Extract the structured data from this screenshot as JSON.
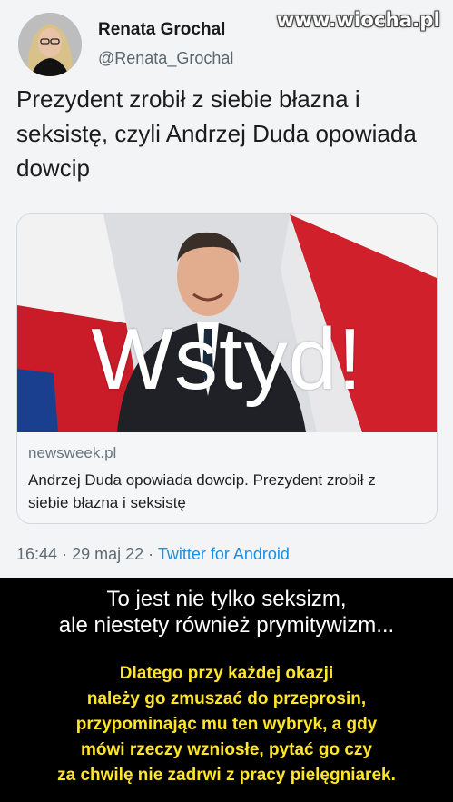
{
  "watermark": "www.wiocha.pl",
  "tweet": {
    "author_name": "Renata Grochal",
    "author_handle": "@Renata_Grochal",
    "text": "Prezydent zrobił z siebie błazna i seksistę, czyli Andrzej Duda opowiada dowcip",
    "card": {
      "image_overlay": "Wstyd!",
      "domain": "newsweek.pl",
      "title": "Andrzej Duda opowiada dowcip. Prezydent zrobił z siebie błazna i seksistę"
    },
    "time": "16:44",
    "date": "29 maj 22",
    "app": "Twitter for Android"
  },
  "caption": {
    "line1": "To jest nie tylko seksizm,",
    "line2": "ale niestety również prymitywizm..."
  },
  "subcaption": {
    "line1": "Dlatego przy każdej okazji",
    "line2": "należy go zmuszać do przeprosin,",
    "line3": "przypominając mu ten wybryk, a gdy",
    "line4": "mówi rzeczy wzniosłe, pytać go czy",
    "line5": "za chwilę nie zadrwi z pracy pielęgniarek."
  },
  "colors": {
    "tweet_bg": "#f3f4f6",
    "link_blue": "#1d8ee0",
    "caption_yellow": "#ffe626",
    "flag_red": "#d0202c"
  }
}
